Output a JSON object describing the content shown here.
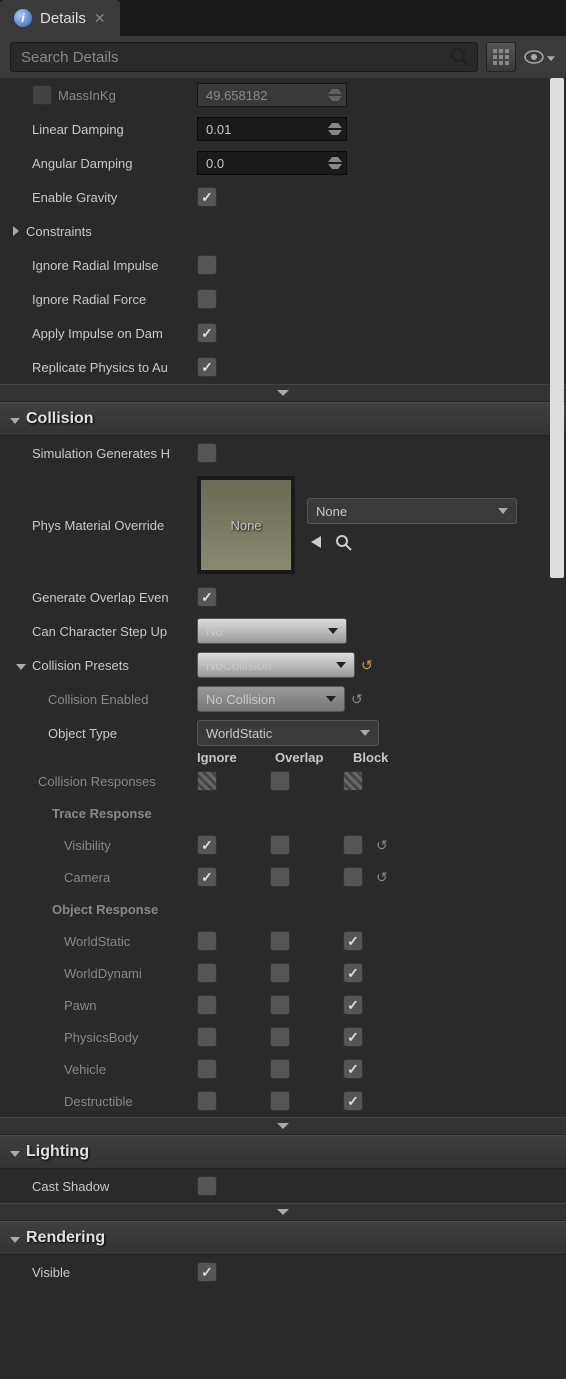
{
  "tab": {
    "title": "Details"
  },
  "search": {
    "placeholder": "Search Details"
  },
  "physics": {
    "mass_label": "MassInKg",
    "mass_value": "49.658182",
    "linear_damping_label": "Linear Damping",
    "linear_damping_value": "0.01",
    "angular_damping_label": "Angular Damping",
    "angular_damping_value": "0.0",
    "enable_gravity_label": "Enable Gravity",
    "enable_gravity": true,
    "constraints_label": "Constraints",
    "ignore_radial_impulse_label": "Ignore Radial Impulse",
    "ignore_radial_impulse": false,
    "ignore_radial_force_label": "Ignore Radial Force",
    "ignore_radial_force": false,
    "apply_impulse_label": "Apply Impulse on Dam",
    "apply_impulse": true,
    "replicate_label": "Replicate Physics to Au",
    "replicate": true
  },
  "collision": {
    "header": "Collision",
    "sim_gen_hits_label": "Simulation Generates H",
    "sim_gen_hits": false,
    "phys_mat_label": "Phys Material Override",
    "phys_mat_thumb": "None",
    "phys_mat_value": "None",
    "gen_overlap_label": "Generate Overlap Even",
    "gen_overlap": true,
    "can_step_label": "Can Character Step Up",
    "can_step_value": "No",
    "presets_label": "Collision Presets",
    "presets_value": "NoCollision",
    "enabled_label": "Collision Enabled",
    "enabled_value": "No Collision",
    "object_type_label": "Object Type",
    "object_type_value": "WorldStatic",
    "col_ignore": "Ignore",
    "col_overlap": "Overlap",
    "col_block": "Block",
    "responses_label": "Collision Responses",
    "trace_label": "Trace Response",
    "object_resp_label": "Object Response",
    "rows": {
      "visibility": "Visibility",
      "camera": "Camera",
      "worldstatic": "WorldStatic",
      "worlddynamic": "WorldDynami",
      "pawn": "Pawn",
      "physicsbody": "PhysicsBody",
      "vehicle": "Vehicle",
      "destructible": "Destructible"
    }
  },
  "lighting": {
    "header": "Lighting",
    "cast_shadow_label": "Cast Shadow",
    "cast_shadow": false
  },
  "rendering": {
    "header": "Rendering",
    "visible_label": "Visible",
    "visible": true
  }
}
